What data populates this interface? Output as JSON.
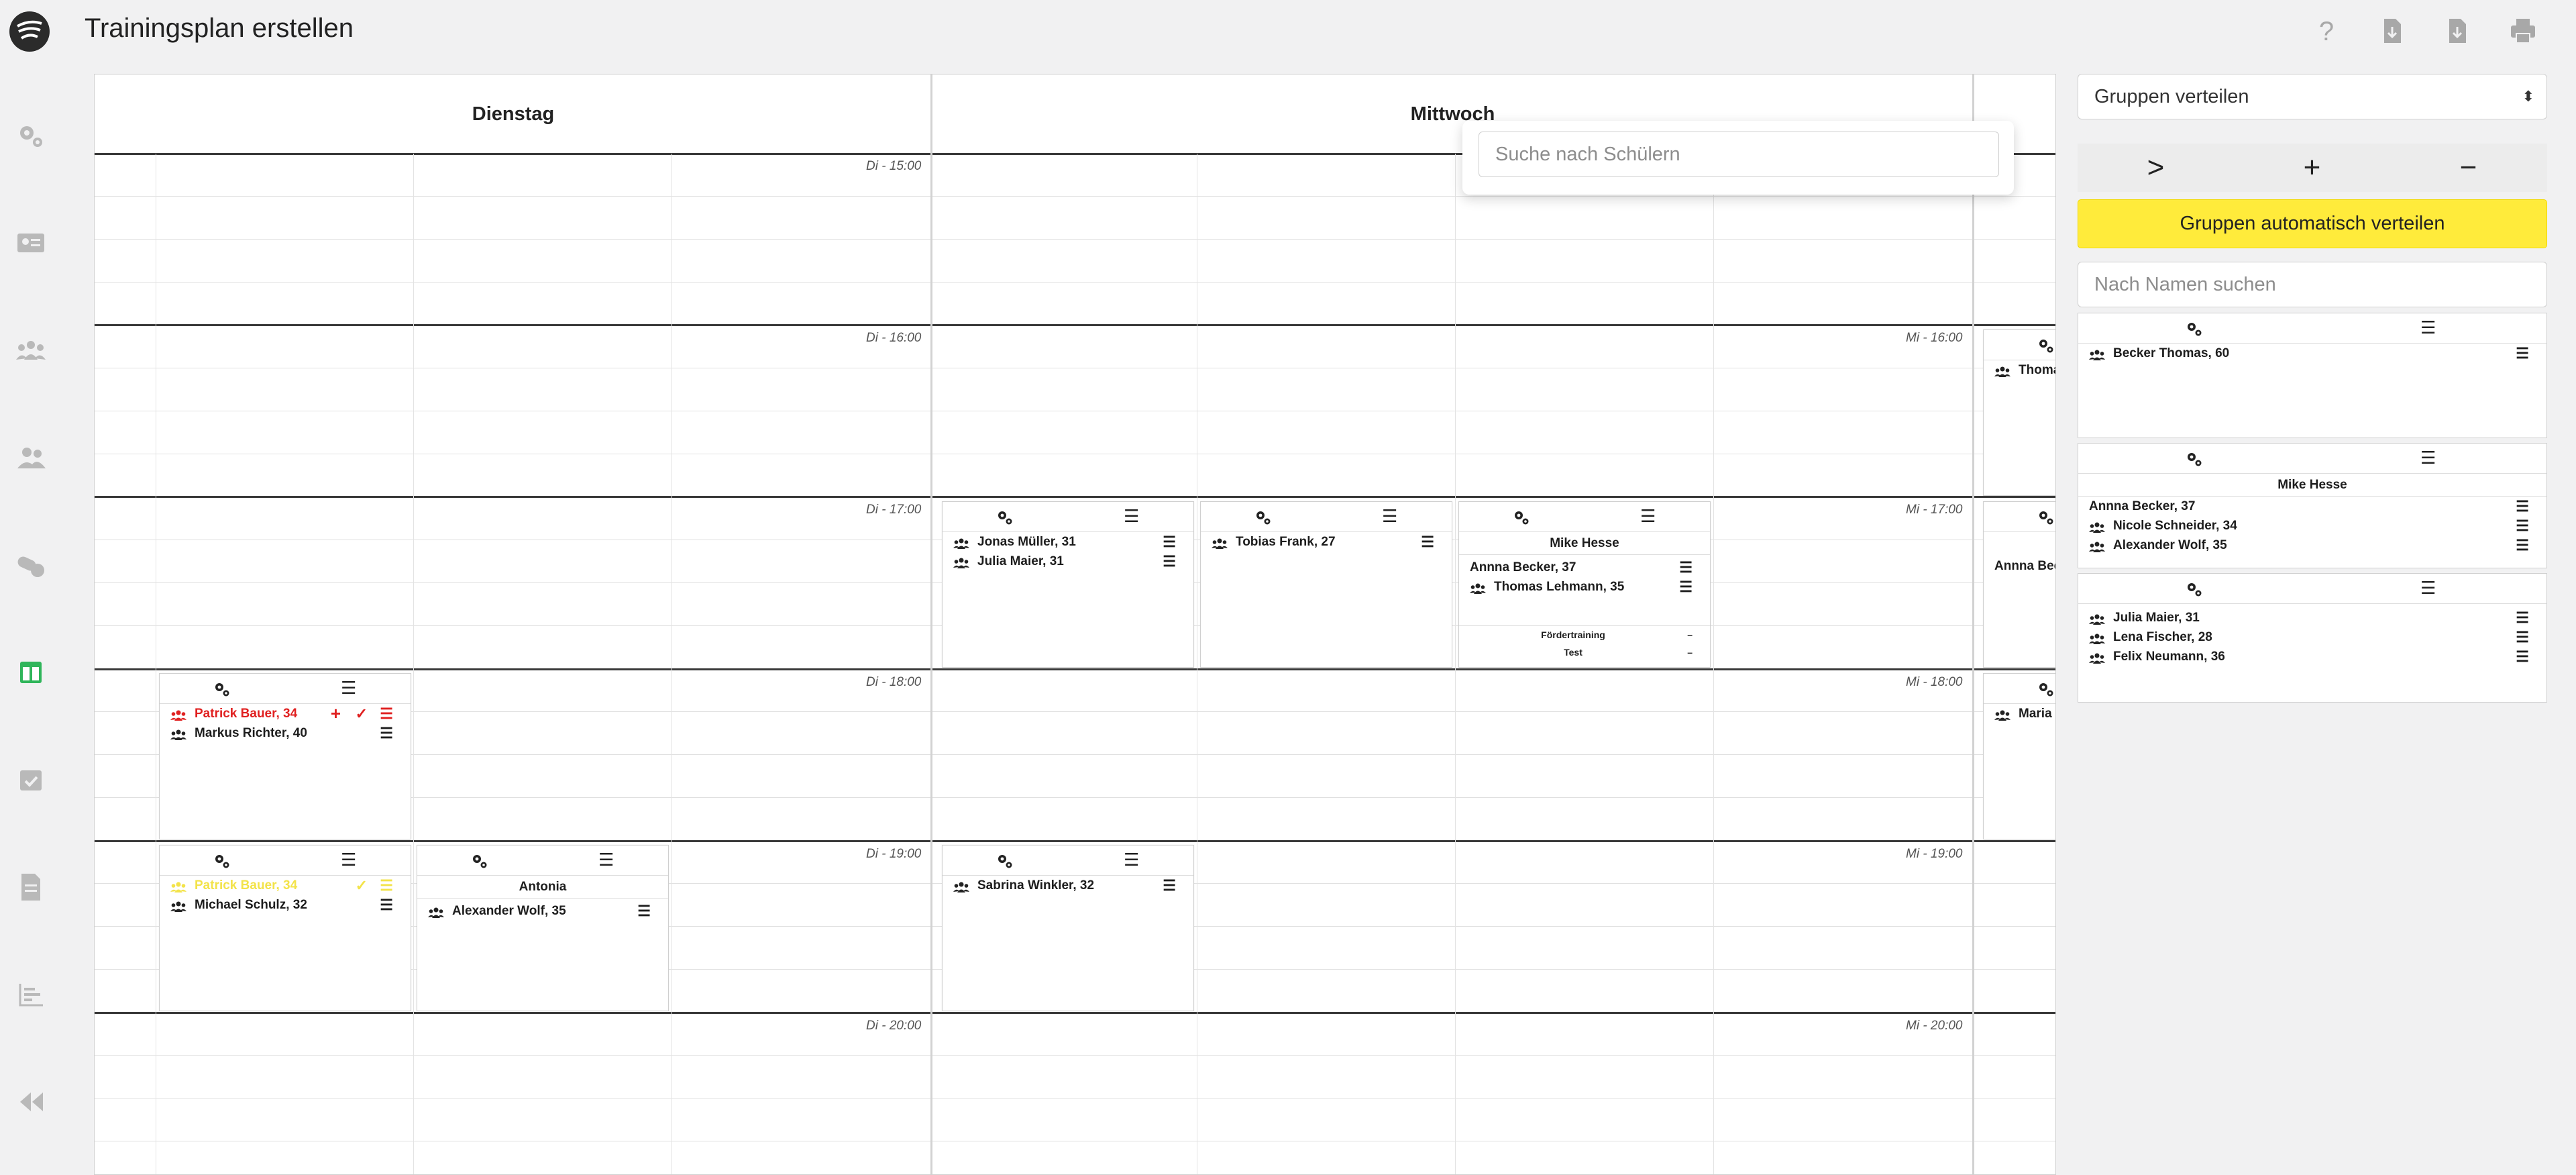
{
  "header": {
    "title": "Trainingsplan erstellen"
  },
  "top_actions": [
    {
      "name": "help-icon"
    },
    {
      "name": "file-download-icon"
    },
    {
      "name": "file-export-icon"
    },
    {
      "name": "print-icon"
    }
  ],
  "sidebar": {
    "items": [
      {
        "name": "settings-gears-icon",
        "active": false
      },
      {
        "name": "id-card-icon",
        "active": false
      },
      {
        "name": "groups-icon",
        "active": false
      },
      {
        "name": "users-icon",
        "active": false
      },
      {
        "name": "pills-icon",
        "active": false
      },
      {
        "name": "table-plan-icon",
        "active": true
      },
      {
        "name": "calendar-check-icon",
        "active": false
      },
      {
        "name": "document-icon",
        "active": false
      },
      {
        "name": "bar-chart-icon",
        "active": false
      },
      {
        "name": "collapse-icon",
        "active": false
      }
    ]
  },
  "calendar": {
    "days": [
      "Dienstag",
      "Mittwoch"
    ],
    "times_di": [
      "Di - 15:00",
      "Di - 16:00",
      "Di - 17:00",
      "Di - 18:00",
      "Di - 19:00",
      "Di - 20:00"
    ],
    "times_mi": [
      "Mi - 16:00",
      "Mi - 17:00",
      "Mi - 18:00",
      "Mi - 19:00",
      "Mi - 20:00"
    ],
    "search_placeholder": "Suche nach Schülern"
  },
  "groups": {
    "mi17_a": {
      "students": [
        "Jonas Müller, 31",
        "Julia Maier, 31"
      ]
    },
    "mi17_b": {
      "students": [
        "Tobias Frank, 27"
      ]
    },
    "mi17_c": {
      "coach": "Mike Hesse",
      "students": [
        "Annna Becker, 37",
        "Thomas Lehmann, 35"
      ],
      "extras": [
        "Fördertraining",
        "Test"
      ],
      "dash": "–"
    },
    "di18_a": {
      "students": [
        "Patrick Bauer, 34",
        "Markus Richter, 40"
      ],
      "plus": "+",
      "check": "✓"
    },
    "di19_a": {
      "students": [
        "Patrick Bauer, 34",
        "Michael Schulz, 32"
      ],
      "check": "✓"
    },
    "di19_b": {
      "coach": "Antonia",
      "students": [
        "Alexander Wolf, 35"
      ]
    },
    "mi19_a": {
      "students": [
        "Sabrina Winkler, 32"
      ]
    },
    "overflow": {
      "mi16": "Thoma",
      "mi17": "Annna Bec",
      "mi18": "Maria"
    }
  },
  "right_panel": {
    "select_value": "Gruppen verteilen",
    "arrow_label": ">",
    "plus_label": "+",
    "minus_label": "−",
    "auto_button": "Gruppen automatisch verteilen",
    "name_search_placeholder": "Nach Namen suchen",
    "cards": {
      "card1": {
        "students": [
          "Becker Thomas, 60"
        ]
      },
      "card2": {
        "coach": "Mike Hesse",
        "students": [
          "Annna Becker, 37",
          "Nicole Schneider, 34",
          "Alexander Wolf, 35"
        ]
      },
      "card3": {
        "students": [
          "Julia Maier, 31",
          "Lena Fischer, 28",
          "Felix Neumann, 36"
        ]
      }
    },
    "accent_color": "#ffeb3b"
  },
  "colors": {
    "active_sidebar": "#2fb55a",
    "warning_red": "#e02020",
    "pending_yellow": "#f3e34a"
  }
}
